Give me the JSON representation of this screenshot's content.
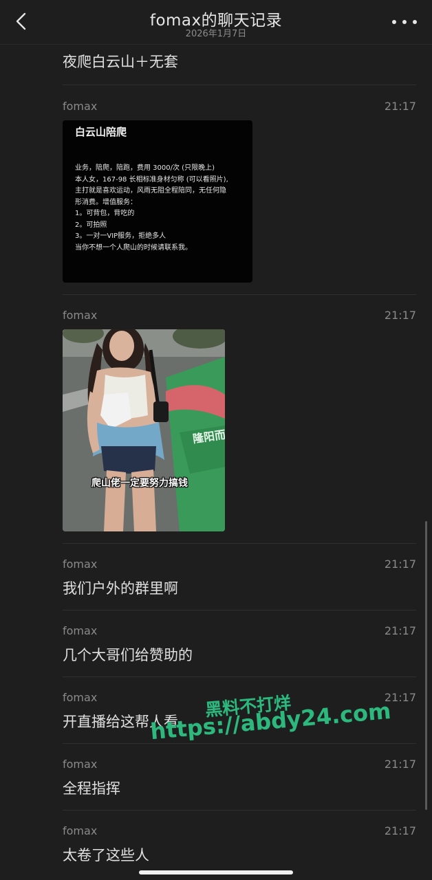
{
  "header": {
    "title": "fomax的聊天记录",
    "date": "2026年1月7日",
    "back_icon": "chevron-left-icon",
    "more_icon": "more-dots-icon"
  },
  "messages": [
    {
      "sender": "",
      "time": "",
      "text": "夜爬白云山＋无套"
    },
    {
      "sender": "fomax",
      "time": "21:17",
      "image_card": {
        "title": "白云山陪爬",
        "lines": [
          "业务，陪爬，陪跑，费用 3000/次 (只限晚上)",
          "本人女，167-98 长相标准身材匀称 (可以看照片),",
          "主打就是喜欢运动，风雨无阻全程陪同，无任何隐",
          "形消费。增值服务：",
          "1。可背包，背吃的",
          "2。可拍照",
          "3。一对一VIP服务，拒绝多人",
          "当你不想一个人爬山的时候请联系我。"
        ]
      }
    },
    {
      "sender": "fomax",
      "time": "21:17",
      "photo": {
        "caption": "爬山佬一定要努力搞钱",
        "sign_text": "隆阳而"
      }
    },
    {
      "sender": "fomax",
      "time": "21:17",
      "text": "我们户外的群里啊"
    },
    {
      "sender": "fomax",
      "time": "21:17",
      "text": "几个大哥们给赞助的"
    },
    {
      "sender": "fomax",
      "time": "21:17",
      "text": "开直播给这帮人看"
    },
    {
      "sender": "fomax",
      "time": "21:17",
      "text": "全程指挥"
    },
    {
      "sender": "fomax",
      "time": "21:17",
      "text": "太卷了这些人"
    }
  ],
  "watermark": {
    "line1": "黑料不打烊",
    "line2": "https://abdy24.com",
    "color": "#2fb87e"
  },
  "colors": {
    "background": "#1e1e1e",
    "text": "#e0e0e0",
    "secondary": "#8a8a8a"
  }
}
